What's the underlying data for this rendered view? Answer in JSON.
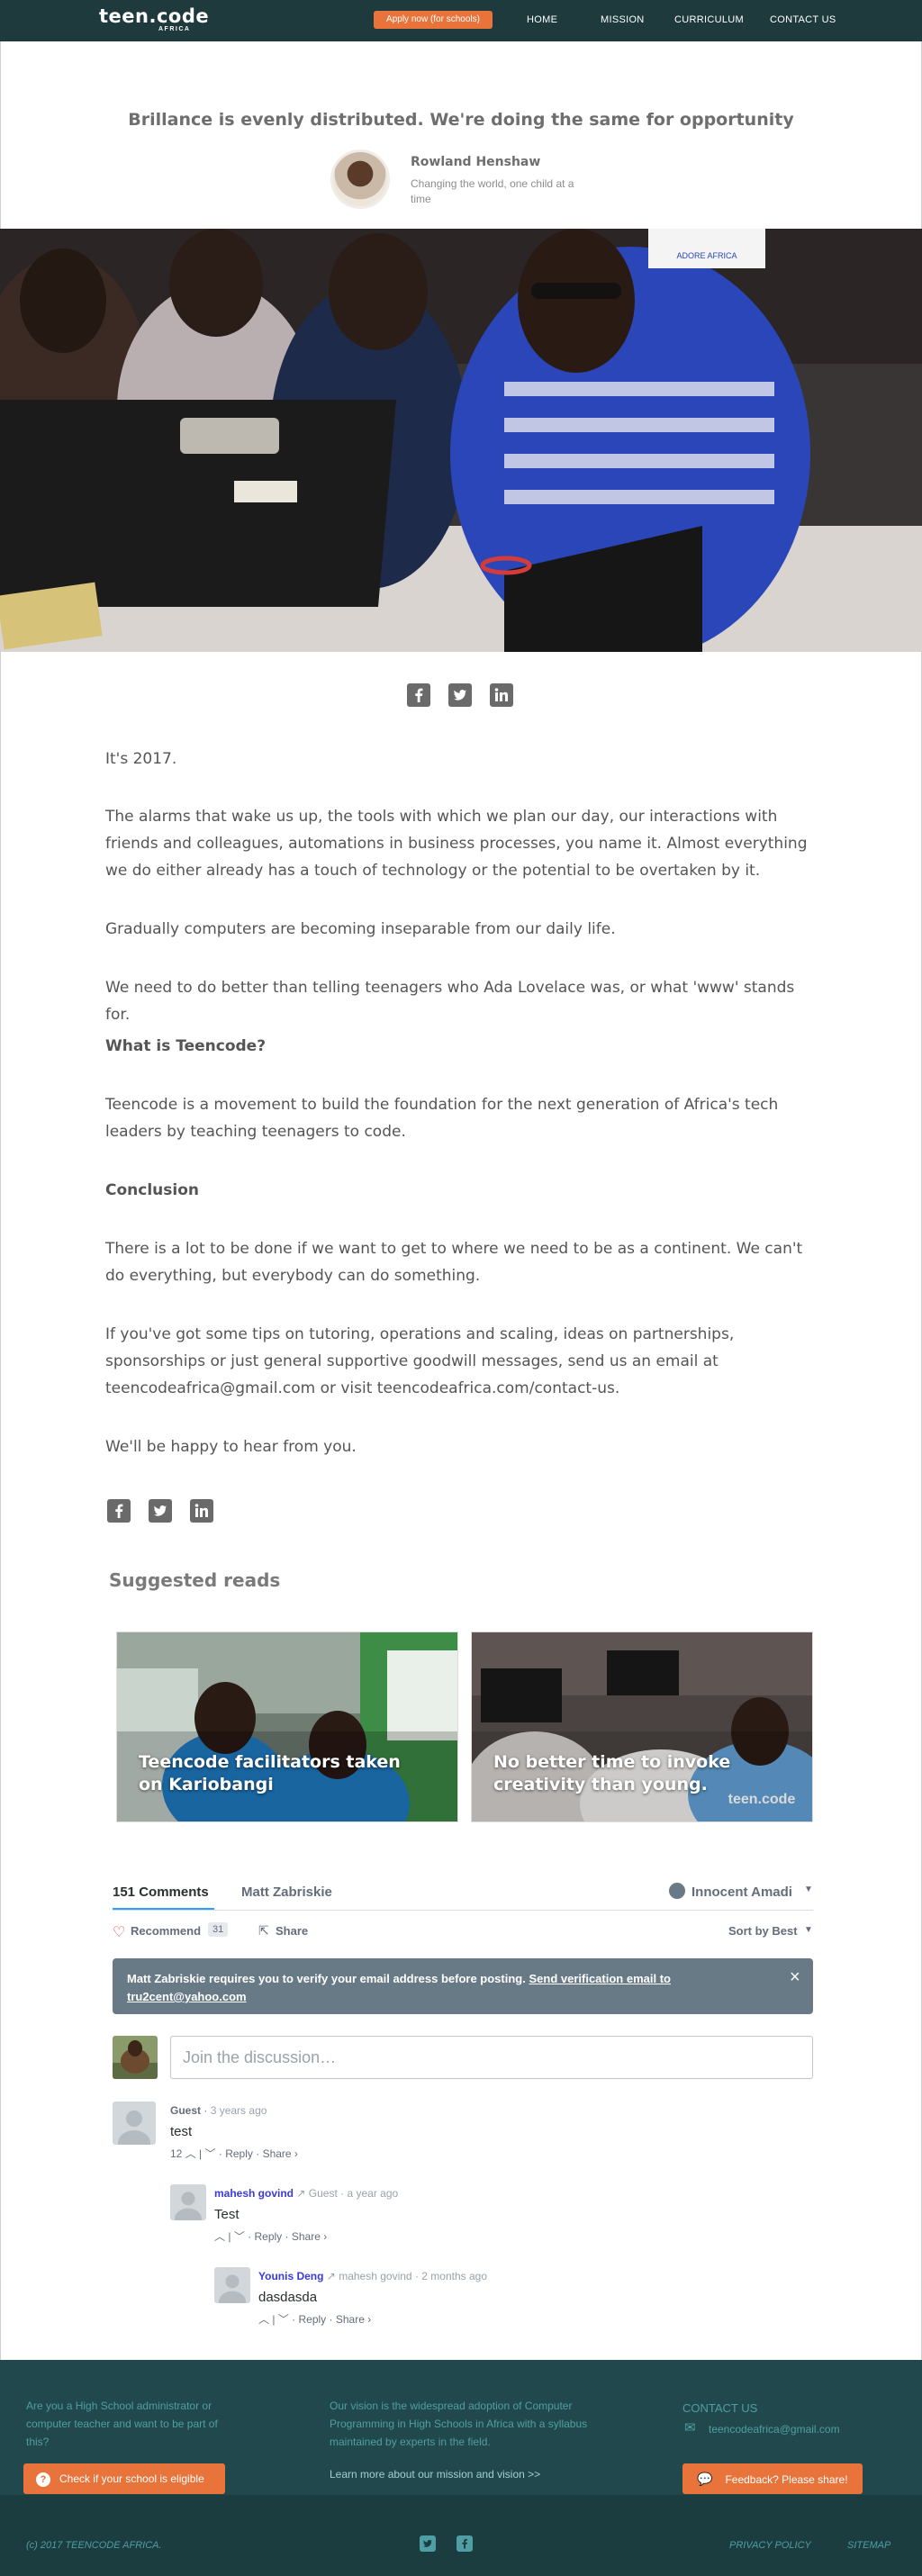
{
  "nav": {
    "logo": "teen.code",
    "logo_sub": "AFRICA",
    "apply_label": "Apply now (for schools)",
    "links": [
      "HOME",
      "MISSION",
      "CURRICULUM",
      "CONTACT US"
    ]
  },
  "article_header": {
    "headline": "Brillance is evenly distributed. We're doing the same for opportunity",
    "author_name": "Rowland Henshaw",
    "author_bio": "Changing the world, one child at a time",
    "photo_caption": "ADORE AFRICA"
  },
  "article": {
    "paragraphs": [
      "It's 2017.",
      "The alarms that wake us up, the tools with which we plan our day, our interactions with friends and colleagues, automations in business processes, you name it. Almost everything we do either already has a touch of technology or the potential to be overtaken by it.",
      "Gradually computers are becoming inseparable from our daily life.",
      "We need to do better than telling teenagers who Ada Lovelace was, or what 'www' stands for.",
      "What is Teencode?",
      "Teencode is a movement to build the foundation for the next generation of Africa's tech leaders by teaching teenagers to code.",
      "Conclusion",
      "There is a lot to be done if we want to get to where we need to be as a continent. We can't do everything, but everybody can do something.",
      "If you've got some tips on tutoring, operations and scaling, ideas on partnerships, sponsorships or just general supportive goodwill messages, send us an email at teencodeafrica@gmail.com or visit teencodeafrica.com/contact-us.",
      "We'll be happy to hear from you."
    ]
  },
  "suggested": {
    "title": "Suggested reads",
    "cards": [
      {
        "title": "Teencode facilitators taken on Kariobangi"
      },
      {
        "title": "No better time to invoke creativity than young."
      }
    ],
    "shirt_text": "teen.code"
  },
  "comments": {
    "count_tab": "151 Comments",
    "community_tab": "Matt Zabriskie",
    "user": "Innocent Amadi",
    "recommend_label": "Recommend",
    "recommend_count": "31",
    "share_label": "Share",
    "sort_label": "Sort by Best",
    "verify_text": "Matt Zabriskie requires you to verify your email address before posting.",
    "verify_link_1": "Send verification email to",
    "verify_link_2": "tru2cent@yahoo.com",
    "input_placeholder": "Join the discussion…",
    "close_icon": "×",
    "list": [
      {
        "author": "Guest",
        "reply_to": "",
        "time": "3 years ago",
        "text": "test",
        "votes": "12",
        "reply": "Reply",
        "share": "Share ›"
      },
      {
        "author": "mahesh govind",
        "reply_to": "Guest",
        "time": "a year ago",
        "text": "Test",
        "votes": "",
        "reply": "Reply",
        "share": "Share ›"
      },
      {
        "author": "Younis Deng",
        "reply_to": "mahesh govind",
        "time": "2 months ago",
        "text": "dasdasda",
        "votes": "",
        "reply": "Reply",
        "share": "Share ›"
      }
    ],
    "colors": {
      "link": "#2e9fff",
      "author_link": "#3a3adb",
      "meta": "#7f919e",
      "text": "#2a2e2e"
    }
  },
  "footer": {
    "col1_text": "Are you a High School administrator or computer teacher and want to be part of this?",
    "col1_button": "Check if your school is eligible",
    "col2_text": "Our vision is the widespread adoption of Computer Programming in High Schools in Africa with a syllabus maintained by experts in the field.",
    "col2_link": "Learn more about our mission and vision >>",
    "col3_title": "CONTACT US",
    "col3_email": "teencodeafrica@gmail.com",
    "col3_button": "Feedback? Please share!",
    "copyright": "(c) 2017 TEENCODE AFRICA.",
    "privacy": "PRIVACY POLICY",
    "sitemap": "SITEMAP"
  },
  "icons": [
    "facebook-icon",
    "twitter-icon",
    "linkedin-icon",
    "heart-icon",
    "share-icon",
    "email-icon",
    "chat-bubble-icon",
    "question-icon"
  ],
  "theme": {
    "accent": "#e8743b",
    "nav_bg": "#1f3a3d",
    "footer_bg": "#21494d",
    "footer_text": "#4f9ea3"
  }
}
